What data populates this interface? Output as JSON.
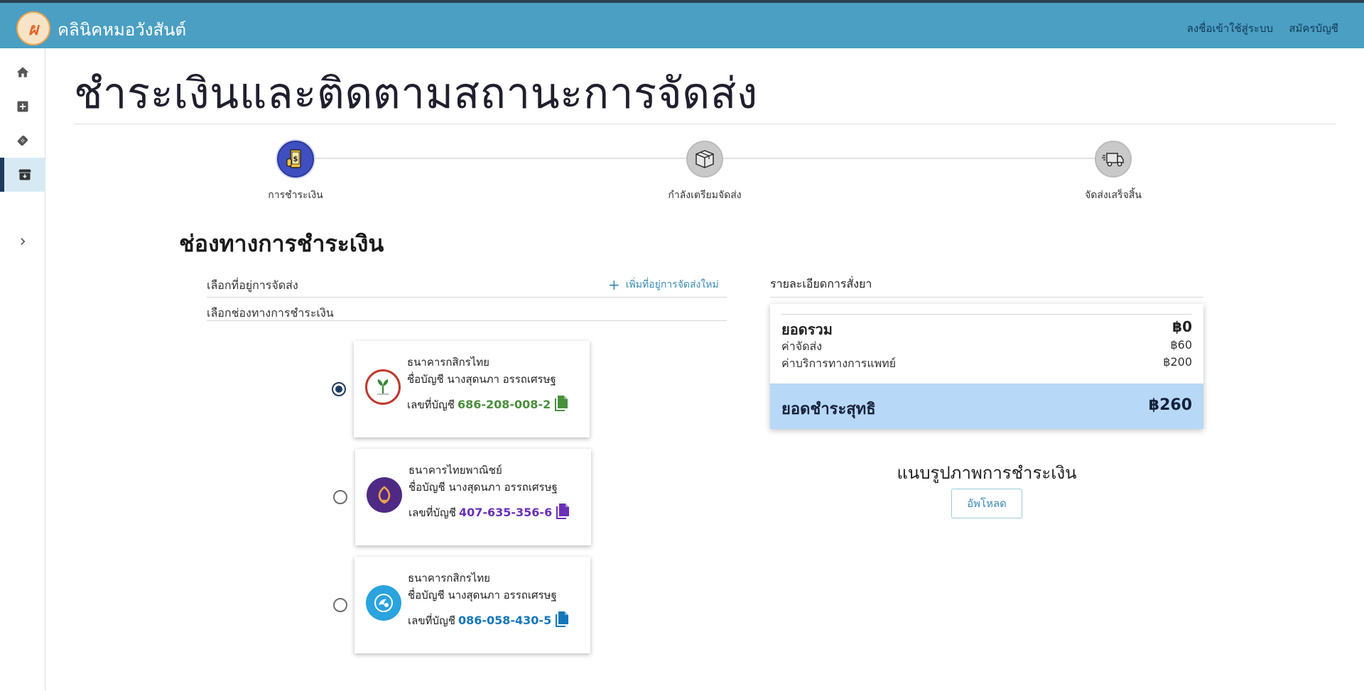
{
  "app": {
    "logo_text": "ผ",
    "title": "คลินิคหมอวังสันต์",
    "login_link": "ลงชื่อเข้าใช้สู่ระบบ",
    "signup_link": "สมัครบัญชี"
  },
  "sidebar": {
    "items": [
      {
        "icon": "home-icon"
      },
      {
        "icon": "medical-plus-icon"
      },
      {
        "icon": "bandage-icon"
      },
      {
        "icon": "archive-box-icon",
        "active": true
      },
      {
        "icon": "chevron-right-icon"
      }
    ]
  },
  "page": {
    "title": "ชำระเงินและติดตามสถานะการจัดส่ง"
  },
  "stepper": {
    "steps": [
      {
        "label": "การชำระเงิน",
        "icon": "payment-phone-icon",
        "active": true
      },
      {
        "label": "กำลังเตรียมจัดส่ง",
        "icon": "package-box-icon",
        "active": false
      },
      {
        "label": "จัดส่งเสร็จสิ้น",
        "icon": "delivery-truck-icon",
        "active": false
      }
    ]
  },
  "payment": {
    "section_title": "ช่องทางการชำระเงิน",
    "address_label": "เลือกที่อยู่การจัดส่ง",
    "add_address": "เพิ่มที่อยู่การจัดส่งใหม่",
    "channel_label": "เลือกช่องทางการชำระเงิน",
    "account_prefix": "เลขที่บัญชี",
    "banks": [
      {
        "name": "ธนาคารกสิกรไทย",
        "account_name": "ชื่อบัญชี นางสุดนภา อรรถเศรษฐ",
        "account_no": "686-208-008-2",
        "color": "#4a8f3c",
        "selected": true,
        "logo": "kasikorn-logo-icon"
      },
      {
        "name": "ธนาคารไทยพาณิชย์",
        "account_name": "ชื่อบัญชี นางสุดนภา อรรถเศรษฐ",
        "account_no": "407-635-356-6",
        "color": "#6a2fb8",
        "selected": false,
        "logo": "scb-logo-icon"
      },
      {
        "name": "ธนาคารกสิกรไทย",
        "account_name": "ชื่อบัญชี นางสุดนภา อรรถเศรษฐ",
        "account_no": "086-058-430-5",
        "color": "#1577b8",
        "selected": false,
        "logo": "krungthai-logo-icon"
      }
    ]
  },
  "order": {
    "title": "รายละเอียดการสั่งยา",
    "total_label": "ยอดรวม",
    "total_value": "฿0",
    "shipping_label": "ค่าจัดส่ง",
    "shipping_value": "฿60",
    "service_label": "ค่าบริการทางการแพทย์",
    "service_value": "฿200",
    "net_label": "ยอดชำระสุทธิ",
    "net_value": "฿260"
  },
  "upload": {
    "title": "แนบรูปภาพการชำระเงิน",
    "button": "อัพโหลด"
  },
  "colors": {
    "header": "#4a9fc3",
    "accent": "#3a8bb5",
    "net_box": "#b8d8f7",
    "stepper_active": "#3f4fc0"
  }
}
